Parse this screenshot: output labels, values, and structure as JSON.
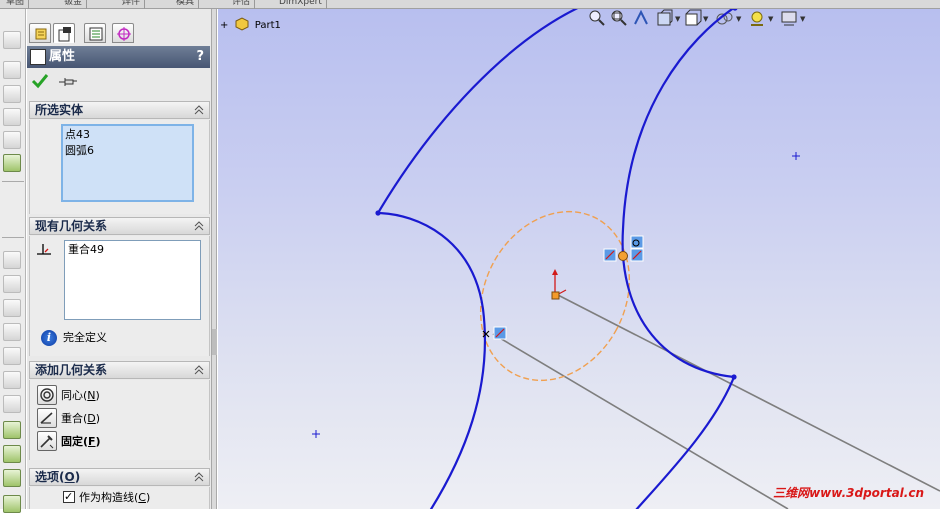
{
  "top_tabs": [
    "草图",
    "钣金",
    "焊件",
    "模具",
    "评估",
    "DimXpert"
  ],
  "property_manager": {
    "title": "属性",
    "help": "?",
    "selected_entities": {
      "header": "所选实体",
      "items": [
        "点43",
        "圆弧6"
      ]
    },
    "existing_relations": {
      "header": "现有几何关系",
      "items": [
        "重合49"
      ],
      "status": "完全定义"
    },
    "add_relations": {
      "header": "添加几何关系",
      "buttons": [
        {
          "label": "同心(",
          "key": "N",
          "suffix": ")",
          "icon": "concentric-icon"
        },
        {
          "label": "重合(",
          "key": "D",
          "suffix": ")",
          "icon": "coincident-icon"
        },
        {
          "label": "固定(",
          "key": "F",
          "suffix": ")",
          "icon": "fix-icon"
        }
      ]
    },
    "options": {
      "header": "选项(",
      "key": "O",
      "suffix": ")",
      "construction_label": "作为构造线(",
      "construction_key": "C",
      "construction_suffix": ")",
      "construction_checked": true
    }
  },
  "viewport": {
    "tree_node": "Part1",
    "tree_expand": "+"
  },
  "watermark": "三维网www.3dportal.cn",
  "colors": {
    "sketch_curve": "#1a1ad0",
    "construction_circle": "#f0a050",
    "title_bar": "#56647e"
  }
}
